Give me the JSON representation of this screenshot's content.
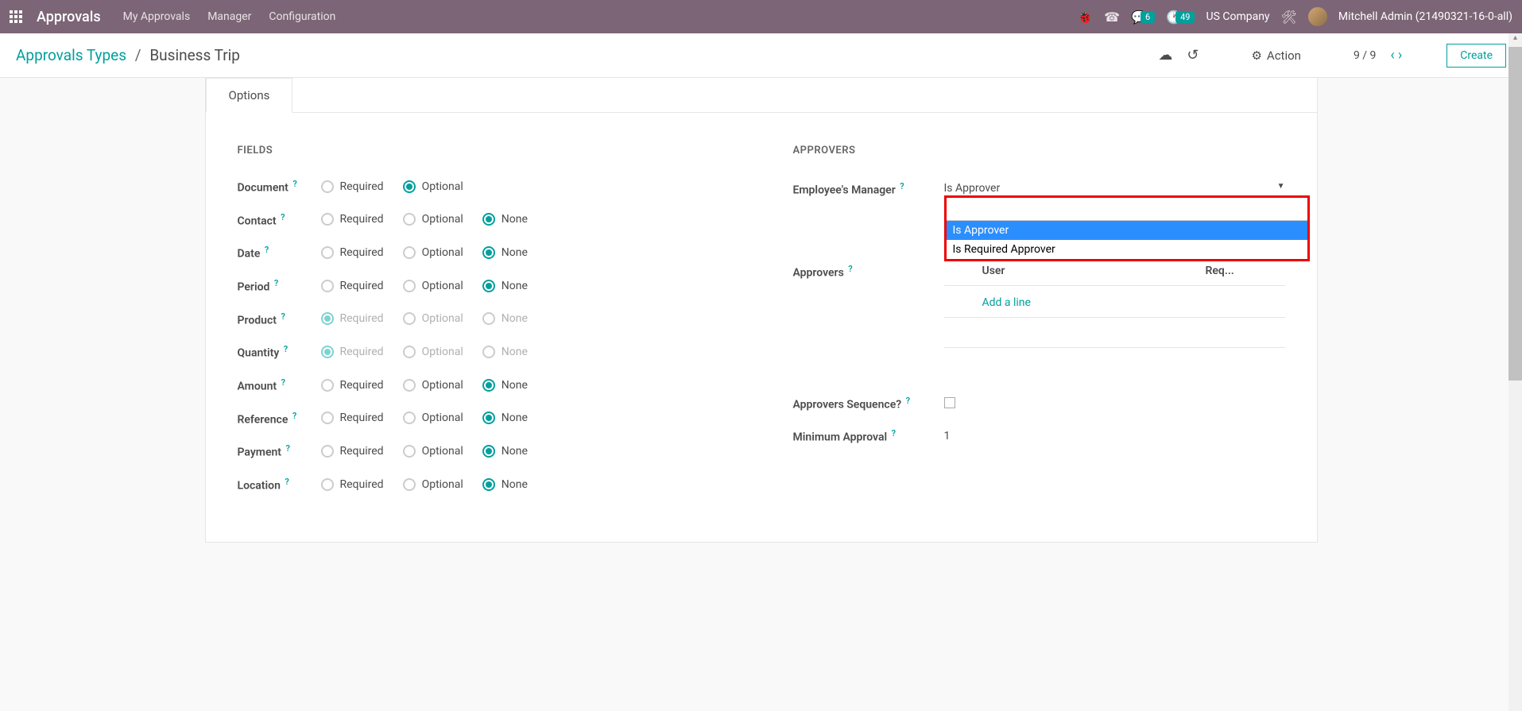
{
  "nav": {
    "app_title": "Approvals",
    "links": [
      "My Approvals",
      "Manager",
      "Configuration"
    ],
    "msg_count": "6",
    "activity_count": "49",
    "company": "US Company",
    "user": "Mitchell Admin (21490321-16-0-all)"
  },
  "control": {
    "breadcrumb_root": "Approvals Types",
    "breadcrumb_current": "Business Trip",
    "action_label": "Action",
    "pager": "9 / 9",
    "create_label": "Create"
  },
  "tabs": {
    "options": "Options"
  },
  "sections": {
    "fields_title": "FIELDS",
    "approvers_title": "APPROVERS"
  },
  "radio_labels": {
    "required": "Required",
    "optional": "Optional",
    "none": "None"
  },
  "fields": [
    {
      "label": "Document",
      "has_none": false,
      "selected": "optional",
      "disabled": false
    },
    {
      "label": "Contact",
      "has_none": true,
      "selected": "none",
      "disabled": false
    },
    {
      "label": "Date",
      "has_none": true,
      "selected": "none",
      "disabled": false
    },
    {
      "label": "Period",
      "has_none": true,
      "selected": "none",
      "disabled": false
    },
    {
      "label": "Product",
      "has_none": true,
      "selected": "required",
      "disabled": true
    },
    {
      "label": "Quantity",
      "has_none": true,
      "selected": "required",
      "disabled": true
    },
    {
      "label": "Amount",
      "has_none": true,
      "selected": "none",
      "disabled": false
    },
    {
      "label": "Reference",
      "has_none": true,
      "selected": "none",
      "disabled": false
    },
    {
      "label": "Payment",
      "has_none": true,
      "selected": "none",
      "disabled": false
    },
    {
      "label": "Location",
      "has_none": true,
      "selected": "none",
      "disabled": false
    }
  ],
  "approvers": {
    "manager_label": "Employee's Manager",
    "manager_value": "Is Approver",
    "dropdown_options": [
      "Is Approver",
      "Is Required Approver"
    ],
    "approvers_label": "Approvers",
    "table_user": "User",
    "table_req": "Req...",
    "add_line": "Add a line",
    "sequence_label": "Approvers Sequence?",
    "min_approval_label": "Minimum Approval",
    "min_approval_value": "1"
  }
}
